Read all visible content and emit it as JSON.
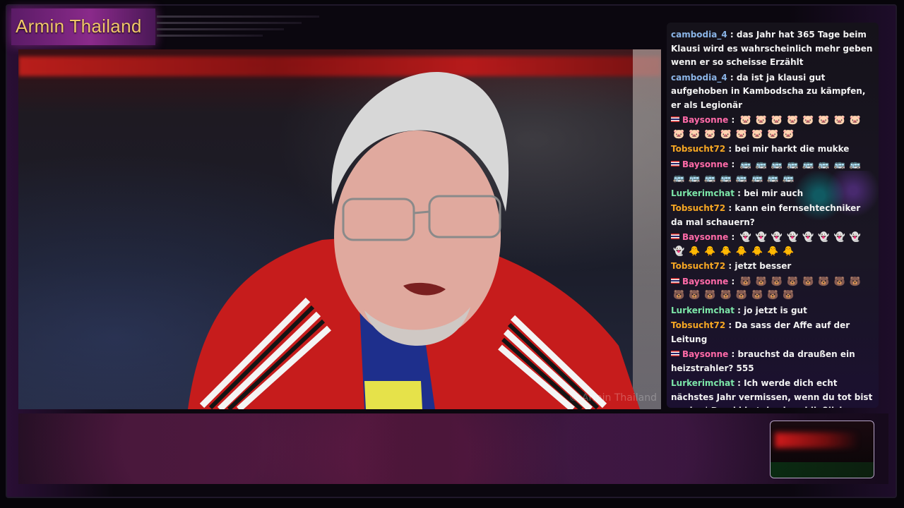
{
  "channel": {
    "title": "Armin Thailand"
  },
  "video": {
    "watermark": "© Armin Thailand"
  },
  "colors": {
    "cambodia": "#8ab4e6",
    "baysonne": "#ff6aa8",
    "tobsucht": "#f5a623",
    "lurker": "#7ce6a8",
    "title": "#f1c66a"
  },
  "chat": {
    "messages": [
      {
        "user": "cambodia_4",
        "text": "das Jahr hat 365 Tage beim Klausi wird es wahrscheinlich mehr geben wenn er so scheisse Erzählt",
        "color": "#8ab4e6",
        "flag": false,
        "emotes": []
      },
      {
        "user": "cambodia_4",
        "text": "da ist ja klausi gut aufgehoben in Kambodscha zu kämpfen, er als Legionär",
        "color": "#8ab4e6",
        "flag": false,
        "emotes": []
      },
      {
        "user": "Baysonne",
        "text": "",
        "color": "#ff6aa8",
        "flag": true,
        "emotes": [
          "🐷",
          "🐷",
          "🐷",
          "🐷",
          "🐷",
          "🐷",
          "🐷",
          "🐷",
          "🐷",
          "🐷",
          "🐷",
          "🐷",
          "🐷",
          "🐷",
          "🐷",
          "🐷"
        ]
      },
      {
        "user": "Tobsucht72",
        "text": "bei mir harkt die mukke",
        "color": "#f5a623",
        "flag": false,
        "emotes": []
      },
      {
        "user": "Baysonne",
        "text": "",
        "color": "#ff6aa8",
        "flag": true,
        "emotes": [
          "🚌",
          "🚌",
          "🚌",
          "🚌",
          "🚌",
          "🚌",
          "🚌",
          "🚌",
          "🚌",
          "🚌",
          "🚌",
          "🚌",
          "🚌",
          "🚌",
          "🚌",
          "🚌"
        ]
      },
      {
        "user": "Lurkerimchat",
        "text": "bei mir auch",
        "color": "#7ce6a8",
        "flag": false,
        "emotes": []
      },
      {
        "user": "Tobsucht72",
        "text": "kann ein fernsehtechniker da mal schauern?",
        "color": "#f5a623",
        "flag": false,
        "emotes": []
      },
      {
        "user": "Baysonne",
        "text": "",
        "color": "#ff6aa8",
        "flag": true,
        "emotes": [
          "👻",
          "👻",
          "👻",
          "👻",
          "👻",
          "👻",
          "👻",
          "👻",
          "👻",
          "🐥",
          "🐥",
          "🐥",
          "🐥",
          "🐥",
          "🐥",
          "🐥"
        ]
      },
      {
        "user": "Tobsucht72",
        "text": "jetzt besser",
        "color": "#f5a623",
        "flag": false,
        "emotes": []
      },
      {
        "user": "Baysonne",
        "text": "",
        "color": "#ff6aa8",
        "flag": true,
        "emotes": [
          "🐻",
          "🐻",
          "🐻",
          "🐻",
          "🐻",
          "🐻",
          "🐻",
          "🐻",
          "🐻",
          "🐻",
          "🐻",
          "🐻",
          "🐻",
          "🐻",
          "🐻",
          "🐻"
        ]
      },
      {
        "user": "Lurkerimchat",
        "text": "jo jetzt is gut",
        "color": "#7ce6a8",
        "flag": false,
        "emotes": []
      },
      {
        "user": "Tobsucht72",
        "text": "Da sass der Affe auf der Leitung",
        "color": "#f5a623",
        "flag": false,
        "emotes": []
      },
      {
        "user": "Baysonne",
        "text": "brauchst da draußen ein heizstrahler? 555",
        "color": "#ff6aa8",
        "flag": true,
        "emotes": []
      },
      {
        "user": "Lurkerimchat",
        "text": "Ich werde dich echt nächstes Jahr vermissen, wenn du tot bist armin :| Drecki hat das ja schließlich behauptet. Muss also wahr sein",
        "color": "#7ce6a8",
        "flag": false,
        "emotes": []
      }
    ]
  }
}
